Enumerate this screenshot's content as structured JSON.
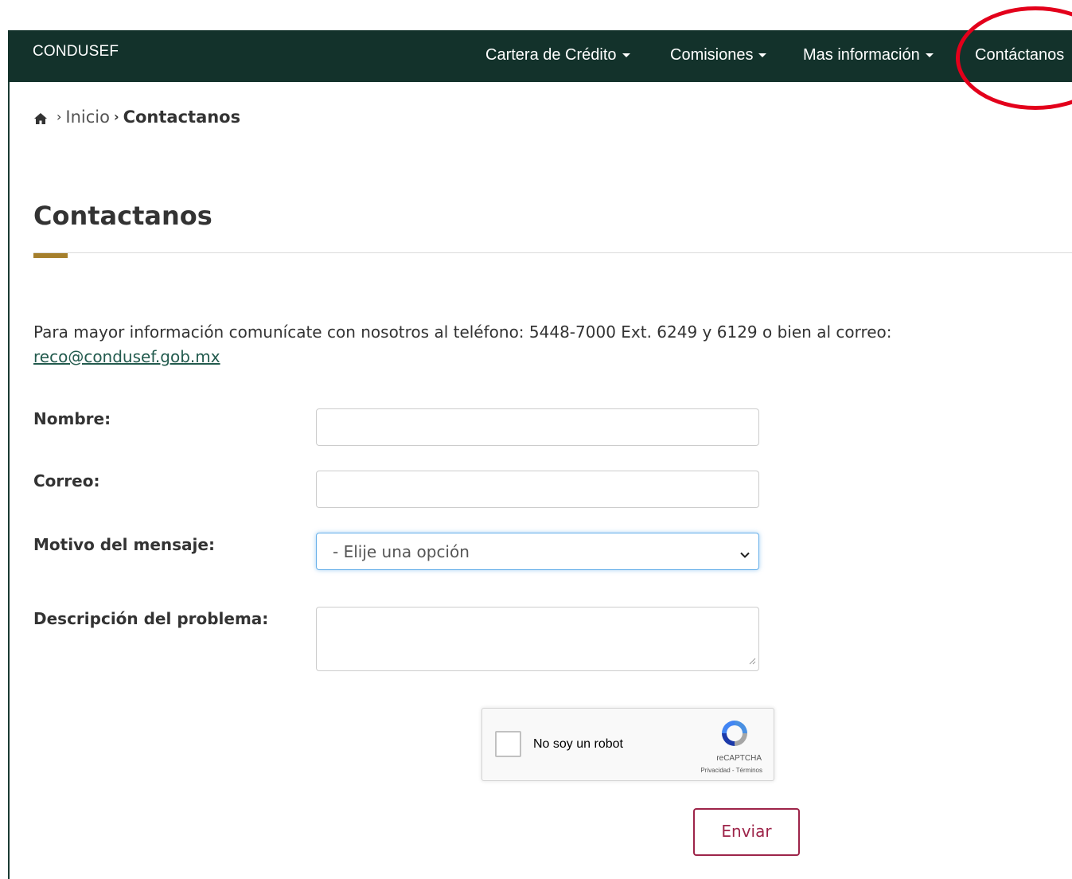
{
  "navbar": {
    "brand": "CONDUSEF",
    "items": [
      {
        "label": "Cartera de Crédito",
        "has_dropdown": true
      },
      {
        "label": "Comisiones",
        "has_dropdown": true
      },
      {
        "label": "Mas información",
        "has_dropdown": true
      },
      {
        "label": "Contáctanos",
        "has_dropdown": false
      }
    ],
    "background_color": "#13322b"
  },
  "breadcrumb": {
    "home_icon": "home-icon",
    "items": [
      "Inicio",
      "Contactanos"
    ]
  },
  "page": {
    "title": "Contactanos",
    "accent_color": "#a57f2c"
  },
  "intro": {
    "text": "Para mayor información comunícate con nosotros al teléfono: 5448-7000 Ext. 6249 y 6129 o bien al correo:",
    "email": "reco@condusef.gob.mx"
  },
  "form": {
    "name_label": "Nombre:",
    "name_value": "",
    "email_label": "Correo:",
    "email_value": "",
    "reason_label": "Motivo del mensaje:",
    "reason_selected": "- Elije una opción",
    "description_label": "Descripción del problema:",
    "description_value": "",
    "submit_label": "Enviar",
    "submit_color": "#9d2449"
  },
  "recaptcha": {
    "label": "No soy un robot",
    "brand": "reCAPTCHA",
    "terms": "Privacidad - Términos"
  },
  "annotation": {
    "highlight_color": "#e3001b"
  }
}
